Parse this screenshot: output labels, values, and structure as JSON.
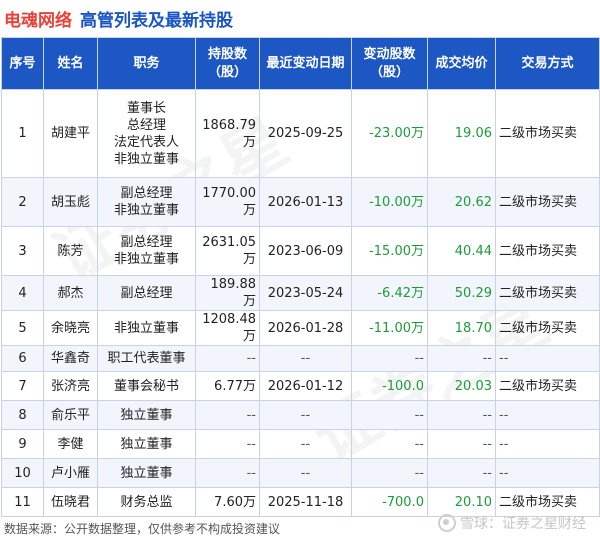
{
  "header": {
    "company": "电魂网络",
    "subtitle": "高管列表及最新持股"
  },
  "table": {
    "columns": [
      "序号",
      "姓名",
      "职务",
      "持股数\n（股）",
      "最近变动日期",
      "变动股数\n（股）",
      "成交均价",
      "交易方式"
    ],
    "rows": [
      {
        "no": "1",
        "name": "胡建平",
        "roles": [
          "董事长",
          "总经理",
          "法定代表人",
          "非独立董事"
        ],
        "holding": "1868.79万",
        "date": "2025-09-25",
        "change": "-23.00万",
        "price": "19.06",
        "method": "二级市场买卖"
      },
      {
        "no": "2",
        "name": "胡玉彪",
        "roles": [
          "副总经理",
          "非独立董事"
        ],
        "holding": "1770.00万",
        "date": "2026-01-13",
        "change": "-10.00万",
        "price": "20.62",
        "method": "二级市场买卖"
      },
      {
        "no": "3",
        "name": "陈芳",
        "roles": [
          "副总经理",
          "非独立董事"
        ],
        "holding": "2631.05万",
        "date": "2023-06-09",
        "change": "-15.00万",
        "price": "40.44",
        "method": "二级市场买卖"
      },
      {
        "no": "4",
        "name": "郝杰",
        "roles": [
          "副总经理"
        ],
        "holding": "189.88万",
        "date": "2023-05-24",
        "change": "-6.42万",
        "price": "50.29",
        "method": "二级市场买卖"
      },
      {
        "no": "5",
        "name": "余晓亮",
        "roles": [
          "非独立董事"
        ],
        "holding": "1208.48万",
        "date": "2026-01-28",
        "change": "-11.00万",
        "price": "18.70",
        "method": "二级市场买卖"
      },
      {
        "no": "6",
        "name": "华鑫奇",
        "roles": [
          "职工代表董事"
        ],
        "holding": "--",
        "date": "--",
        "change": "--",
        "price": "--",
        "method": "--"
      },
      {
        "no": "7",
        "name": "张济亮",
        "roles": [
          "董事会秘书"
        ],
        "holding": "6.77万",
        "date": "2026-01-12",
        "change": "-100.0",
        "price": "20.03",
        "method": "二级市场买卖"
      },
      {
        "no": "8",
        "name": "俞乐平",
        "roles": [
          "独立董事"
        ],
        "holding": "--",
        "date": "--",
        "change": "--",
        "price": "--",
        "method": "--"
      },
      {
        "no": "9",
        "name": "李健",
        "roles": [
          "独立董事"
        ],
        "holding": "--",
        "date": "--",
        "change": "--",
        "price": "--",
        "method": "--"
      },
      {
        "no": "10",
        "name": "卢小雁",
        "roles": [
          "独立董事"
        ],
        "holding": "--",
        "date": "--",
        "change": "--",
        "price": "--",
        "method": "--"
      },
      {
        "no": "11",
        "name": "伍晓君",
        "roles": [
          "财务总监"
        ],
        "holding": "7.60万",
        "date": "2025-11-18",
        "change": "-700.0",
        "price": "20.10",
        "method": "二级市场买卖"
      }
    ]
  },
  "footer": {
    "source": "数据来源：公开数据整理，仅供参考不构成投资建议",
    "brand": "雪球：证券之星财经"
  },
  "colors": {
    "company": "#e8423a",
    "header_bg": "#1d57c3",
    "negative": "#1f9a3a"
  }
}
